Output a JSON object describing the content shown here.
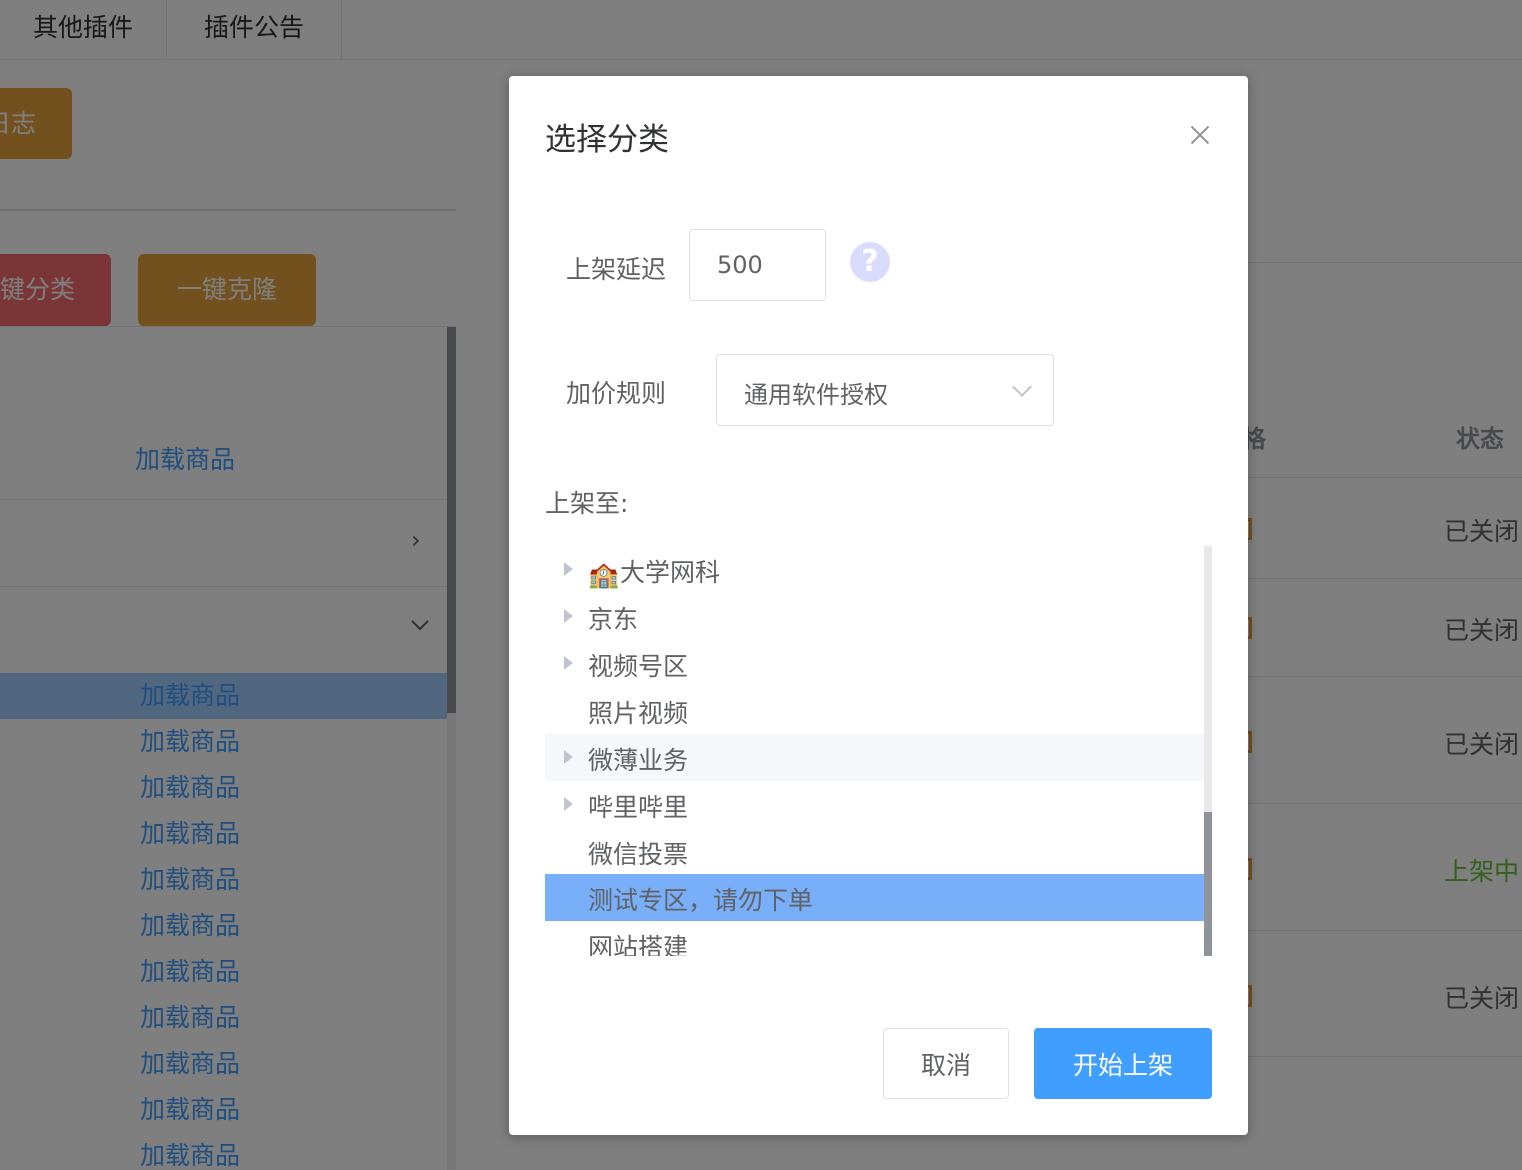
{
  "top_tabs": [
    "其他插件",
    "插件公告"
  ],
  "buttons": {
    "log": "日志",
    "category": "一键分类",
    "clone": "一键克隆"
  },
  "left_panel": {
    "load_label": "加载商品",
    "items": [
      "加载商品",
      "加载商品",
      "加载商品",
      "加载商品",
      "加载商品",
      "加载商品",
      "加载商品",
      "加载商品",
      "加载商品",
      "加载商品",
      "加载商品"
    ]
  },
  "right_panel": {
    "header_status": "状态",
    "header_fragment": "格",
    "rows": [
      {
        "status": "已关闭",
        "state": "off"
      },
      {
        "status": "已关闭",
        "state": "off"
      },
      {
        "status": "已关闭",
        "state": "off"
      },
      {
        "status": "上架中",
        "state": "on"
      },
      {
        "status": "已关闭",
        "state": "off"
      }
    ]
  },
  "dialog": {
    "title": "选择分类",
    "delay_label": "上架延迟",
    "delay_value": "500",
    "rule_label": "加价规则",
    "rule_value": "通用软件授权",
    "target_label": "上架至:",
    "tree": [
      {
        "label": "大学网科",
        "emoji": "🏫",
        "expandable": true
      },
      {
        "label": "京东",
        "expandable": true
      },
      {
        "label": "视频号区",
        "expandable": true
      },
      {
        "label": "照片视频",
        "expandable": false
      },
      {
        "label": "微薄业务",
        "expandable": true,
        "hover": true
      },
      {
        "label": "哔里哔里",
        "expandable": true
      },
      {
        "label": "微信投票",
        "expandable": false
      },
      {
        "label": "测试专区，请勿下单",
        "expandable": false,
        "selected": true
      },
      {
        "label": "网站搭建",
        "expandable": false
      }
    ],
    "cancel_label": "取消",
    "start_label": "开始上架"
  },
  "colors": {
    "primary": "#409eff",
    "warning": "#e6a23c",
    "danger": "#f56c6c",
    "success": "#67c23a",
    "tree_selected": "#79aef8"
  }
}
